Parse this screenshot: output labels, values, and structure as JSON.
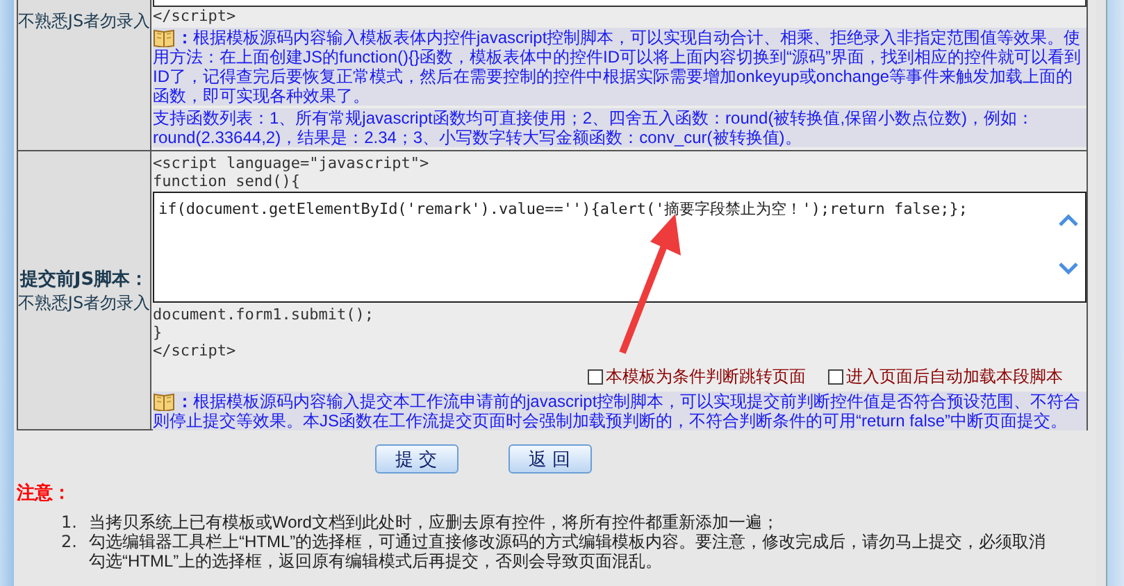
{
  "form_rows": [
    {
      "kind": "tail",
      "note": "不熟悉JS者勿录入",
      "code_after": [
        "</script>"
      ],
      "help_paragraphs": [
        "**：**根据模板源码内容输入模板表体内控件javascript控制脚本，可以实现自动合计、相乘、拒绝录入非指定范围值等效果。使用方法：在上面创建JS的function(){}函数，模板表体中的控件ID可以将上面内容切换到“源码”界面，找到相应的控件就可以看到ID了，记得查完后要恢复正常模式，然后在需要控制的控件中根据实际需要增加onkeyup或onchange等事件来触发加载上面的函数，即可实现各种效果了。",
        "支持函数列表：1、所有常规javascript函数均可直接使用；2、四舍五入函数：round(被转换值,保留小数点位数)，例如：round(2.33644,2)，结果是：2.34；3、小写数字转大写金额函数：conv_cur(被转换值)。"
      ]
    },
    {
      "kind": "full",
      "label": "提交前JS脚本：",
      "note": "不熟悉JS者勿录入",
      "code_before": [
        "<script language=\"javascript\">",
        "function send(){"
      ],
      "editor_value": "if(document.getElementById('remark').value==''){alert('摘要字段禁止为空！');return false;};",
      "code_after": [
        "document.form1.submit();",
        "}",
        "</script>"
      ],
      "checkboxes": [
        {
          "label": "本模板为条件判断跳转页面",
          "checked": false
        },
        {
          "label": "进入页面后自动加载本段脚本",
          "checked": false
        }
      ],
      "help_paragraphs": [
        "**：**根据模板源码内容输入提交本工作流申请前的javascript控制脚本，可以实现提交前判断控件值是否符合预设范围、不符合则停止提交等效果。本JS函数在工作流提交页面时会强制加载预判断的，不符合判断条件的可用“return false”中断页面提交。"
      ]
    }
  ],
  "buttons": [
    {
      "label": "提 交"
    },
    {
      "label": "返 回"
    }
  ],
  "notice": {
    "title": "注意：",
    "items": [
      {
        "number": "1.",
        "text": "当拷贝系统上已有模板或Word文档到此处时，应删去原有控件，将所有控件都重新添加一遍；"
      },
      {
        "number": "2.",
        "text": "勾选编辑器工具栏上“HTML”的选择框，可通过直接修改源码的方式编辑模板内容。要注意，修改完成后，请勿马上提交，必须取消勾选“HTML”上的选择框，返回原有编辑模式后再提交，否则会导致页面混乱。"
      }
    ]
  }
}
